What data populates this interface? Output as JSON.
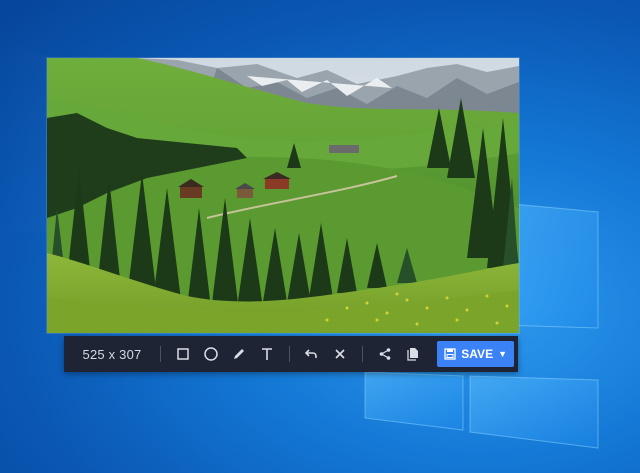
{
  "desktop": {
    "background": "#1477d4"
  },
  "capture": {
    "alt": "Green alpine meadow with chalets, pine trees and snowy mountains"
  },
  "toolbar": {
    "dimensions": "525 x 307",
    "tools": [
      {
        "name": "rectangle-tool",
        "icon": "square-outline"
      },
      {
        "name": "ellipse-tool",
        "icon": "circle-outline"
      },
      {
        "name": "pen-tool",
        "icon": "pencil"
      },
      {
        "name": "text-tool",
        "icon": "letter-T"
      },
      {
        "name": "undo",
        "icon": "undo-arrow"
      },
      {
        "name": "close",
        "icon": "x"
      },
      {
        "name": "share",
        "icon": "share-nodes"
      },
      {
        "name": "copy",
        "icon": "copy-pages"
      }
    ],
    "save_label": "SAVE",
    "save_color": "#3b82f6"
  }
}
